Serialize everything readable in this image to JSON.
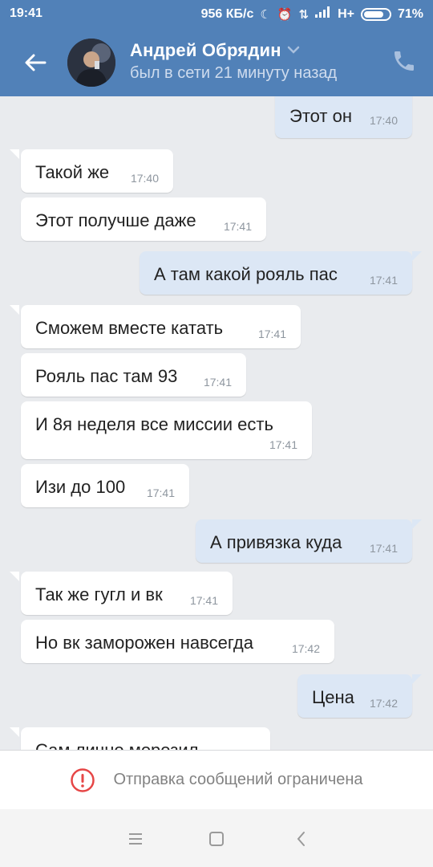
{
  "status_bar": {
    "time": "19:41",
    "net_speed": "956 КБ/с",
    "network": "H+",
    "battery": "71%",
    "icons": [
      "moon-icon",
      "alarm-icon",
      "data-arrows-icon",
      "signal-icon",
      "battery-icon"
    ]
  },
  "header": {
    "contact_name": "Андрей Обрядин",
    "last_seen": "был в сети 21 минуту назад",
    "icons": [
      "back-arrow-icon",
      "chevron-down-icon",
      "phone-icon"
    ]
  },
  "messages": [
    {
      "dir": "out",
      "text": "Этот он",
      "time": "17:40"
    },
    {
      "dir": "in",
      "text": "Такой же",
      "time": "17:40"
    },
    {
      "dir": "in",
      "text": "Этот получше даже",
      "time": "17:41"
    },
    {
      "dir": "out",
      "text": "А там какой рояль пас",
      "time": "17:41"
    },
    {
      "dir": "in",
      "text": "Сможем вместе катать",
      "time": "17:41"
    },
    {
      "dir": "in",
      "text": "Рояль пас там 93",
      "time": "17:41"
    },
    {
      "dir": "in",
      "text": "И 8я неделя все миссии есть",
      "time": "17:41"
    },
    {
      "dir": "in",
      "text": "Изи до 100",
      "time": "17:41"
    },
    {
      "dir": "out",
      "text": "А привязка куда",
      "time": "17:41"
    },
    {
      "dir": "in",
      "text": "Так же гугл и вк",
      "time": "17:41"
    },
    {
      "dir": "in",
      "text": "Но вк заморожен навсегда",
      "time": "17:42"
    },
    {
      "dir": "out",
      "text": "Цена",
      "time": "17:42"
    },
    {
      "dir": "in",
      "text": "Сам лично морозил",
      "time": ""
    }
  ],
  "restriction": {
    "text": "Отправка сообщений ограничена",
    "icon": "alert-circle-icon"
  },
  "nav": {
    "icons": [
      "menu-icon",
      "home-square-icon",
      "back-chevron-icon"
    ]
  },
  "colors": {
    "header": "#5181b8",
    "chat_bg": "#e9ebee",
    "bubble_in": "#ffffff",
    "bubble_out": "#dce7f5",
    "alert": "#e64646"
  }
}
